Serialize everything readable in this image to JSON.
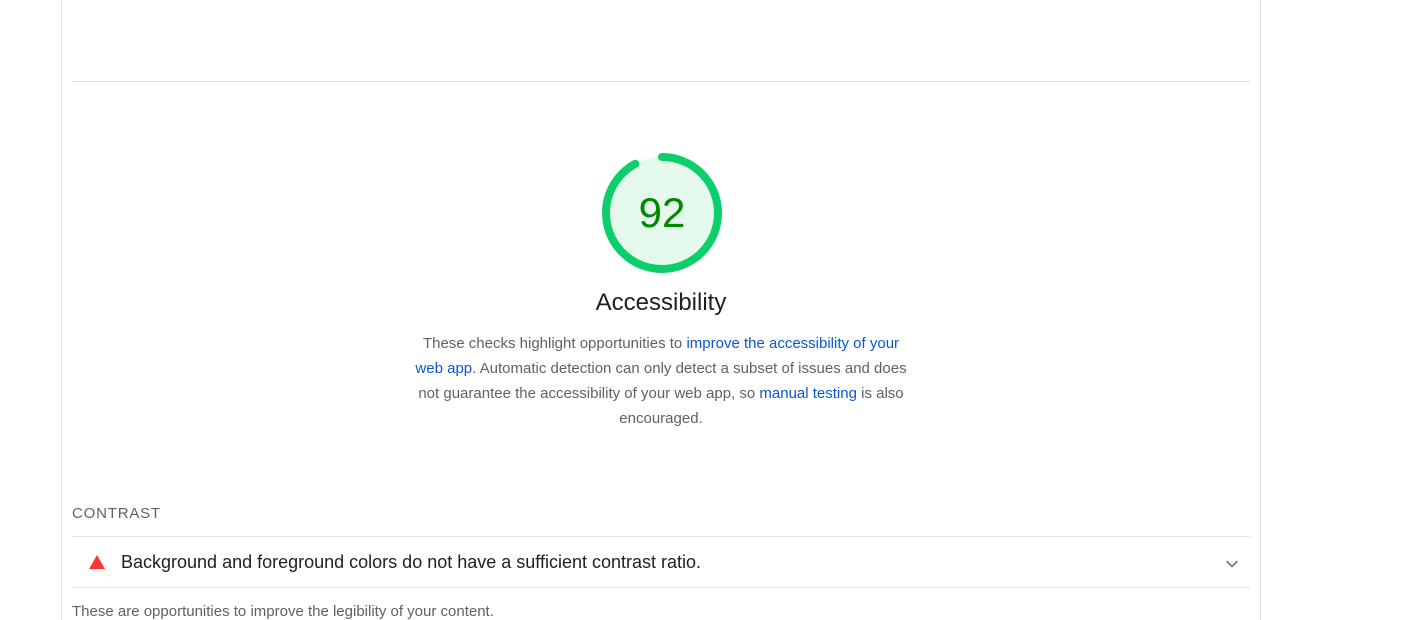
{
  "category": {
    "score": "92",
    "score_fraction": 0.92,
    "title": "Accessibility",
    "description_pre": "These checks highlight opportunities to ",
    "description_link1": "improve the accessibility of your web app",
    "description_mid": ". Automatic detection can only detect a subset of issues and does not guarantee the accessibility of your web app, so ",
    "description_link2": "manual testing",
    "description_post": " is also encouraged.",
    "colors": {
      "pass_ring": "#0cce6b",
      "pass_fill": "#e5f8ec",
      "pass_text": "#008800",
      "fail_icon": "#ff3333",
      "link": "#0b57d0"
    }
  },
  "group": {
    "title": "CONTRAST",
    "description": "These are opportunities to improve the legibility of your content."
  },
  "audits": [
    {
      "title": "Background and foreground colors do not have a sufficient contrast ratio.",
      "status_icon": "fail-triangle-icon",
      "expand_icon": "chevron-down-icon"
    }
  ]
}
